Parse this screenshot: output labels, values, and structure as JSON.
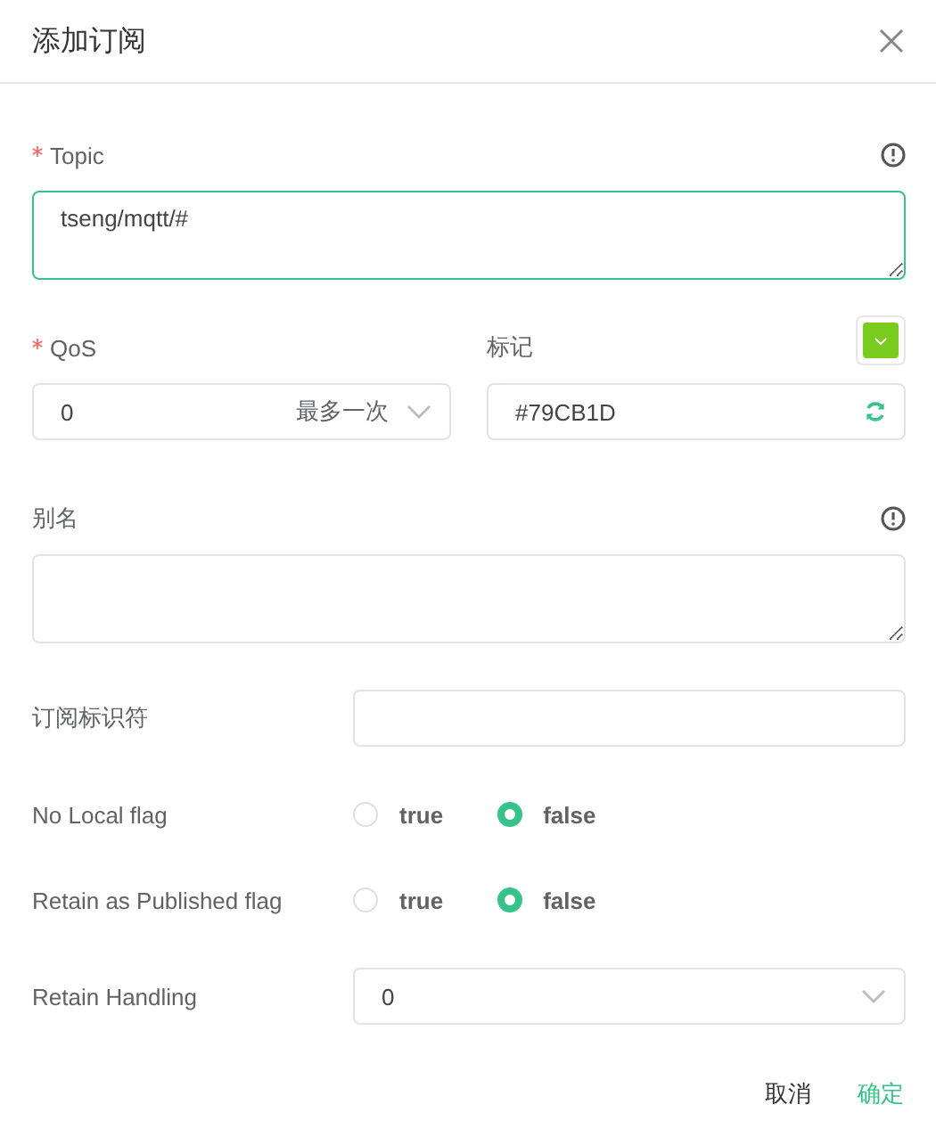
{
  "dialog": {
    "title": "添加订阅"
  },
  "topic": {
    "label": "Topic",
    "required": true,
    "value": "tseng/mqtt/#"
  },
  "qos": {
    "label": "QoS",
    "required": true,
    "value": "0",
    "description": "最多一次"
  },
  "mark": {
    "label": "标记",
    "value": "#79CB1D"
  },
  "alias": {
    "label": "别名"
  },
  "subscription_identifier": {
    "label": "订阅标识符"
  },
  "flags": [
    {
      "label": "No Local flag",
      "options": [
        {
          "label": "true",
          "selected": false
        },
        {
          "label": "false",
          "selected": true
        }
      ]
    },
    {
      "label": "Retain as Published flag",
      "options": [
        {
          "label": "true",
          "selected": false
        },
        {
          "label": "false",
          "selected": true
        }
      ]
    }
  ],
  "retain_handling": {
    "label": "Retain Handling",
    "value": "0"
  },
  "buttons": [
    {
      "label": "取消",
      "kind": "cancel"
    },
    {
      "label": "确定",
      "kind": "primary"
    }
  ]
}
